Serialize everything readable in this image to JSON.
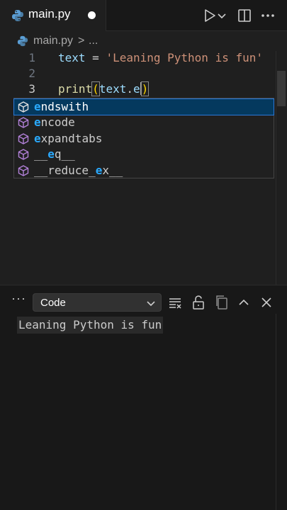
{
  "tab": {
    "filename": "main.py"
  },
  "breadcrumb": {
    "file": "main.py",
    "separator": ">",
    "more": "..."
  },
  "editor": {
    "line_numbers": [
      "1",
      "2",
      "3"
    ],
    "line1": {
      "var": "text",
      "op": " = ",
      "str": "'Leaning Python is fun'"
    },
    "line3": {
      "fn": "print",
      "open": "(",
      "var": "text",
      "dot": ".",
      "typed": "e",
      "close": ")"
    }
  },
  "suggestions": [
    {
      "pre": "",
      "hl": "e",
      "post": "ndswith",
      "kind": "method-icon"
    },
    {
      "pre": "",
      "hl": "e",
      "post": "ncode",
      "kind": "method-icon"
    },
    {
      "pre": "",
      "hl": "e",
      "post": "xpandtabs",
      "kind": "method-icon"
    },
    {
      "pre": "__",
      "hl": "e",
      "post": "q__",
      "kind": "method-icon"
    },
    {
      "pre": "__reduce_",
      "hl": "e",
      "post": "x__",
      "kind": "method-icon"
    }
  ],
  "panel": {
    "more": "···",
    "selector_value": "Code",
    "output": "Leaning Python is fun"
  },
  "colors": {
    "accent": "#2aaaff",
    "selection": "#04395e",
    "string": "#ce9178",
    "variable": "#9cdcfe",
    "function": "#dcdcaa"
  }
}
